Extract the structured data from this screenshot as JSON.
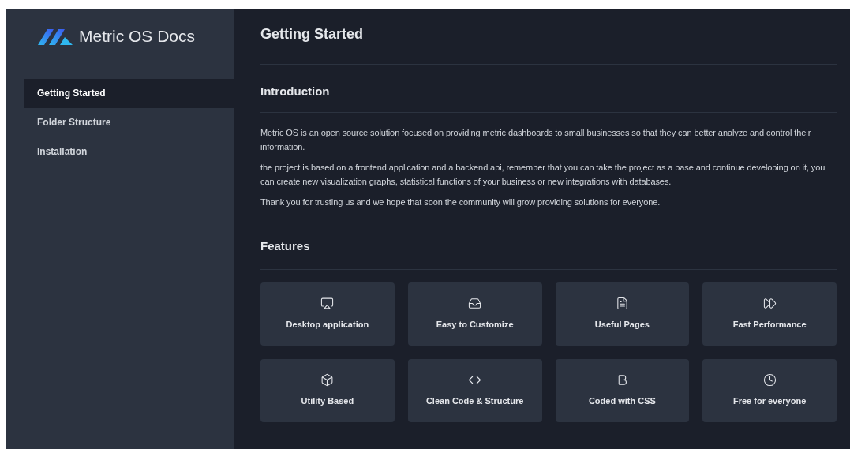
{
  "sidebar": {
    "brand": "Metric OS Docs",
    "items": [
      {
        "label": "Getting Started",
        "selected": true
      },
      {
        "label": "Folder Structure",
        "selected": false
      },
      {
        "label": "Installation",
        "selected": false
      }
    ]
  },
  "page_title": "Getting Started",
  "introduction": {
    "heading": "Introduction",
    "paragraphs": [
      "Metric OS is an open source solution focused on providing metric dashboards to small businesses so that they can better analyze and control their information.",
      "the project is based on a frontend application and a backend api, remember that you can take the project as a base and continue developing on it, you can create new visualization graphs, statistical functions of your business or new integrations with databases.",
      "Thank you for trusting us and we hope that soon the community will grow providing solutions for everyone."
    ]
  },
  "features": {
    "heading": "Features",
    "items": [
      "Desktop application",
      "Easy to Customize",
      "Useful Pages",
      "Fast Performance",
      "Utility Based",
      "Clean Code & Structure",
      "Coded with CSS",
      "Free for everyone"
    ]
  }
}
